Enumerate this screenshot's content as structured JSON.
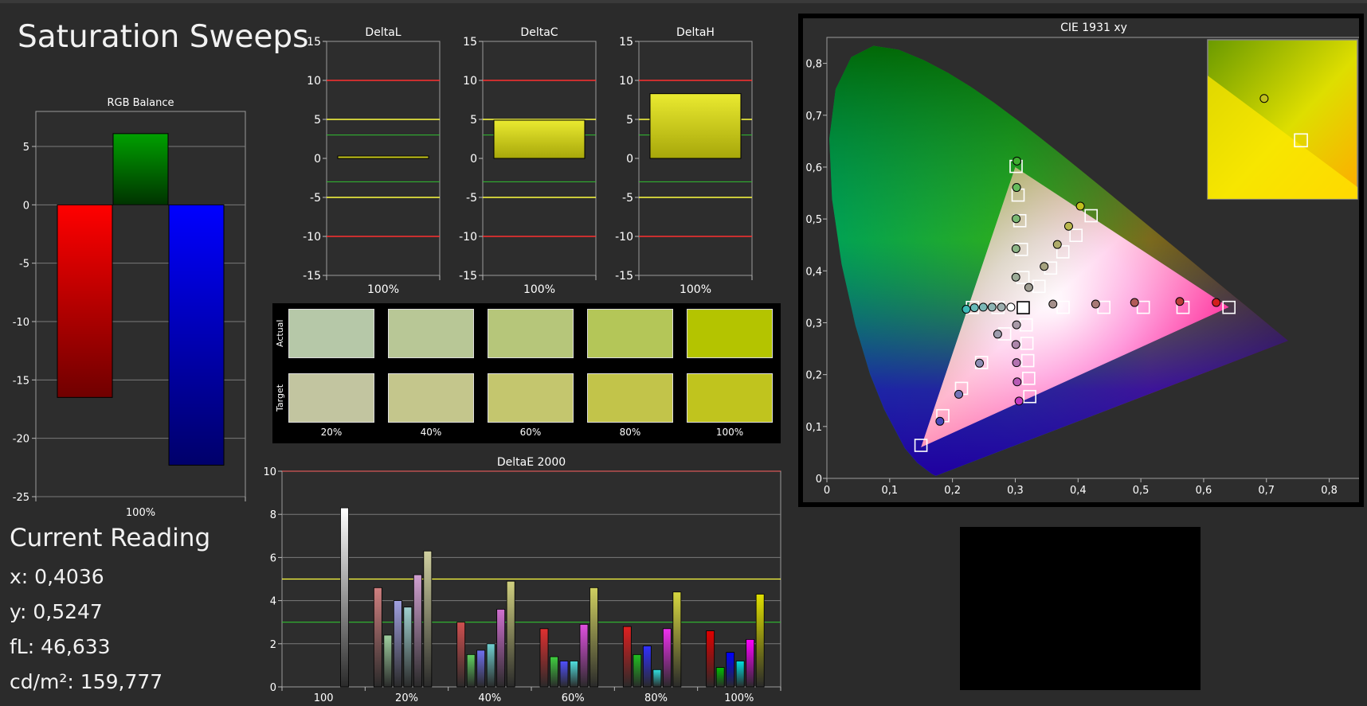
{
  "title": "Saturation Sweeps",
  "current_reading": {
    "title": "Current Reading",
    "x": "x: 0,4036",
    "y": "y: 0,5247",
    "fl": "fL: 46,633",
    "cdm2": "cd/m²: 159,777"
  },
  "colors": {
    "background": "#2b2b2b",
    "panel": "#2d2d2d",
    "red_limit": "#ff3030",
    "yellow_limit": "#ffff40",
    "green_limit": "#30c030"
  },
  "chart_data": [
    {
      "id": "rgb-balance",
      "type": "bar",
      "title": "RGB Balance",
      "categories": [
        "100%"
      ],
      "series": [
        {
          "values": [
            -16.5
          ],
          "color": "#ff0000"
        },
        {
          "values": [
            6.1
          ],
          "color": "#00a000"
        },
        {
          "values": [
            -22.3
          ],
          "color": "#0000ff"
        }
      ],
      "ylim": [
        -25,
        8
      ],
      "yticks": [
        5,
        0,
        -5,
        -10,
        -15,
        -20,
        -25
      ],
      "grid": true
    },
    {
      "id": "delta-l",
      "type": "bar",
      "title": "DeltaL",
      "categories": [
        "100%"
      ],
      "values": [
        0.3
      ],
      "ylim": [
        -15,
        15
      ],
      "yticks": [
        15,
        10,
        5,
        0,
        -5,
        -10,
        -15
      ],
      "limits": {
        "red": 10,
        "yellow": 5,
        "green": 3
      }
    },
    {
      "id": "delta-c",
      "type": "bar",
      "title": "DeltaC",
      "categories": [
        "100%"
      ],
      "values": [
        4.9
      ],
      "ylim": [
        -15,
        15
      ],
      "yticks": [
        15,
        10,
        5,
        0,
        -5,
        -10,
        -15
      ],
      "limits": {
        "red": 10,
        "yellow": 5,
        "green": 3
      }
    },
    {
      "id": "delta-h",
      "type": "bar",
      "title": "DeltaH",
      "categories": [
        "100%"
      ],
      "values": [
        8.3
      ],
      "ylim": [
        -15,
        15
      ],
      "yticks": [
        15,
        10,
        5,
        0,
        -5,
        -10,
        -15
      ],
      "limits": {
        "red": 10,
        "yellow": 5,
        "green": 3
      }
    },
    {
      "id": "swatches",
      "type": "table",
      "row_labels": [
        "Actual",
        "Target"
      ],
      "columns": [
        "20%",
        "40%",
        "60%",
        "80%",
        "100%"
      ],
      "actual_colors": [
        "#b6c8a8",
        "#b8c796",
        "#b6c67a",
        "#b4c658",
        "#b4c400"
      ],
      "target_colors": [
        "#c2c5a0",
        "#c4c68c",
        "#c4c66e",
        "#c2c44a",
        "#c0c41e"
      ]
    },
    {
      "id": "deltae-2000",
      "type": "bar",
      "title": "DeltaE 2000",
      "categories": [
        "100",
        "20%",
        "40%",
        "60%",
        "80%",
        "100%"
      ],
      "ylim": [
        0,
        10
      ],
      "yticks": [
        0,
        2,
        4,
        6,
        8,
        10
      ],
      "limits": {
        "yellow": 5,
        "green": 3
      },
      "groups": [
        {
          "values": [
            null,
            null,
            null,
            null,
            null,
            8.3
          ]
        },
        {
          "values": [
            4.6,
            2.4,
            4.0,
            3.7,
            5.2,
            6.3
          ]
        },
        {
          "values": [
            3.0,
            1.5,
            1.7,
            2.0,
            3.6,
            4.9
          ]
        },
        {
          "values": [
            2.7,
            1.4,
            1.2,
            1.2,
            2.9,
            4.6
          ]
        },
        {
          "values": [
            2.8,
            1.5,
            1.9,
            0.8,
            2.7,
            4.4
          ]
        },
        {
          "values": [
            2.6,
            0.9,
            1.6,
            1.2,
            2.2,
            4.3
          ]
        }
      ],
      "bar_colors": [
        [
          "#555555",
          "#555555",
          "#555555",
          "#555555",
          "#555555",
          "#ffffff"
        ],
        [
          "#d08080",
          "#a0d0a0",
          "#a0a0e0",
          "#a0d0d0",
          "#d0a0d0",
          "#d0d0a0"
        ],
        [
          "#d05050",
          "#60d060",
          "#7070f0",
          "#70d0d0",
          "#d070d0",
          "#d0d080"
        ],
        [
          "#e03030",
          "#40d040",
          "#5050ff",
          "#50e0e0",
          "#e050e0",
          "#d0d060"
        ],
        [
          "#e02020",
          "#20c020",
          "#3030ff",
          "#30e0e0",
          "#f030f0",
          "#d8d840"
        ],
        [
          "#e00000",
          "#00c000",
          "#0000ff",
          "#00e0e0",
          "#ff00ff",
          "#e0e000"
        ]
      ]
    },
    {
      "id": "cie-1931",
      "type": "scatter",
      "title": "CIE 1931 xy",
      "xlim": [
        0,
        0.85
      ],
      "ylim": [
        0,
        0.85
      ],
      "xticks": [
        "0",
        "0,1",
        "0,2",
        "0,3",
        "0,4",
        "0,5",
        "0,6",
        "0,7",
        "0,8"
      ],
      "yticks": [
        "0",
        "0,1",
        "0,2",
        "0,3",
        "0,4",
        "0,5",
        "0,6",
        "0,7",
        "0,8"
      ],
      "gamut": [
        [
          0.64,
          0.33
        ],
        [
          0.3,
          0.6
        ],
        [
          0.15,
          0.06
        ]
      ],
      "white": [
        0.3127,
        0.329
      ],
      "targets": [
        [
          0.3013,
          0.6013
        ],
        [
          0.3045,
          0.5461
        ],
        [
          0.3072,
          0.4967
        ],
        [
          0.3098,
          0.4413
        ],
        [
          0.3122,
          0.3872
        ],
        [
          0.4208,
          0.5063
        ],
        [
          0.3967,
          0.4684
        ],
        [
          0.3758,
          0.4366
        ],
        [
          0.3563,
          0.4054
        ],
        [
          0.3378,
          0.3701
        ],
        [
          0.3762,
          0.3298
        ],
        [
          0.4411,
          0.3297
        ],
        [
          0.5039,
          0.3297
        ],
        [
          0.5671,
          0.3296
        ],
        [
          0.6403,
          0.3296
        ],
        [
          0.2318,
          0.3294
        ],
        [
          0.2725,
          0.3294
        ],
        [
          0.2831,
          0.2785
        ],
        [
          0.2463,
          0.2233
        ],
        [
          0.2144,
          0.1735
        ],
        [
          0.1846,
          0.1209
        ],
        [
          0.1498,
          0.0636
        ],
        [
          0.3174,
          0.2958
        ],
        [
          0.3186,
          0.2603
        ],
        [
          0.3199,
          0.227
        ],
        [
          0.3214,
          0.1928
        ],
        [
          0.3231,
          0.1577
        ]
      ],
      "measured": [
        {
          "x": 0.3026,
          "y": 0.6117,
          "c": "#3fae30"
        },
        {
          "x": 0.3021,
          "y": 0.5607,
          "c": "#66bb5c"
        },
        {
          "x": 0.3014,
          "y": 0.5006,
          "c": "#79b873"
        },
        {
          "x": 0.3011,
          "y": 0.4427,
          "c": "#8db587"
        },
        {
          "x": 0.3009,
          "y": 0.3878,
          "c": "#9bab97"
        },
        {
          "x": 0.4036,
          "y": 0.5247,
          "c": "#c0c01e"
        },
        {
          "x": 0.385,
          "y": 0.486,
          "c": "#b9b64d"
        },
        {
          "x": 0.367,
          "y": 0.4508,
          "c": "#afab6a"
        },
        {
          "x": 0.346,
          "y": 0.4085,
          "c": "#a6a27f"
        },
        {
          "x": 0.3215,
          "y": 0.368,
          "c": "#9e9c91"
        },
        {
          "x": 0.36,
          "y": 0.336,
          "c": "#a38f8a"
        },
        {
          "x": 0.428,
          "y": 0.336,
          "c": "#a87976"
        },
        {
          "x": 0.49,
          "y": 0.339,
          "c": "#b15b58"
        },
        {
          "x": 0.562,
          "y": 0.341,
          "c": "#bb3b38"
        },
        {
          "x": 0.62,
          "y": 0.339,
          "c": "#d31f1d"
        },
        {
          "x": 0.222,
          "y": 0.326,
          "c": "#3ebab7"
        },
        {
          "x": 0.235,
          "y": 0.329,
          "c": "#66b9b7"
        },
        {
          "x": 0.249,
          "y": 0.33,
          "c": "#7bb7b6"
        },
        {
          "x": 0.263,
          "y": 0.33,
          "c": "#8db4b3"
        },
        {
          "x": 0.278,
          "y": 0.33,
          "c": "#9dafaf"
        },
        {
          "x": 0.293,
          "y": 0.33,
          "c": "#ffffff"
        },
        {
          "x": 0.272,
          "y": 0.278,
          "c": "#9d9dad"
        },
        {
          "x": 0.243,
          "y": 0.222,
          "c": "#8d8db3"
        },
        {
          "x": 0.21,
          "y": 0.162,
          "c": "#7474b8"
        },
        {
          "x": 0.18,
          "y": 0.11,
          "c": "#4848ba"
        },
        {
          "x": 0.302,
          "y": 0.296,
          "c": "#a99aa8"
        },
        {
          "x": 0.301,
          "y": 0.258,
          "c": "#ae86ac"
        },
        {
          "x": 0.302,
          "y": 0.223,
          "c": "#b272b0"
        },
        {
          "x": 0.303,
          "y": 0.186,
          "c": "#b75bb5"
        },
        {
          "x": 0.306,
          "y": 0.149,
          "c": "#c43ac0"
        }
      ],
      "inset": {
        "point": [
          0.4036,
          0.5247
        ],
        "target": [
          0.4208,
          0.5063
        ]
      }
    }
  ]
}
